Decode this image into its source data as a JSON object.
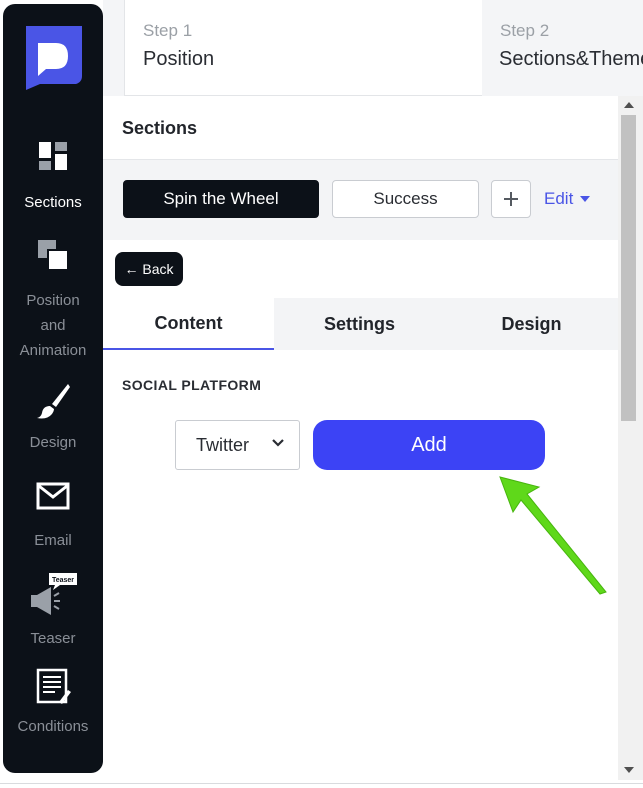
{
  "sidebar": {
    "items": [
      {
        "label": "Sections",
        "icon": "sections-icon",
        "active": true
      },
      {
        "label": "Position and Animation",
        "lines": [
          "Position",
          "and",
          "Animation"
        ],
        "icon": "position-animation-icon"
      },
      {
        "label": "Design",
        "icon": "brush-icon"
      },
      {
        "label": "Email",
        "icon": "envelope-icon"
      },
      {
        "label": "Teaser",
        "icon": "megaphone-icon",
        "badge": "Teaser"
      },
      {
        "label": "Conditions",
        "icon": "conditions-icon"
      }
    ]
  },
  "steps": [
    {
      "number": "Step 1",
      "name": "Position"
    },
    {
      "number": "Step 2",
      "name": "Sections&Theme"
    }
  ],
  "panel": {
    "title": "Sections",
    "section_tabs": [
      "Spin the Wheel",
      "Success"
    ],
    "edit_label": "Edit",
    "back_label": "← Back",
    "subtabs": [
      "Content",
      "Settings",
      "Design"
    ],
    "social_platform_label": "SOCIAL PLATFORM",
    "platform_value": "Twitter",
    "add_label": "Add"
  },
  "colors": {
    "sidebar_bg": "#0c1118",
    "accent": "#4a55e6",
    "add_button": "#3c43f5",
    "annotation_arrow": "#5fd81a"
  }
}
